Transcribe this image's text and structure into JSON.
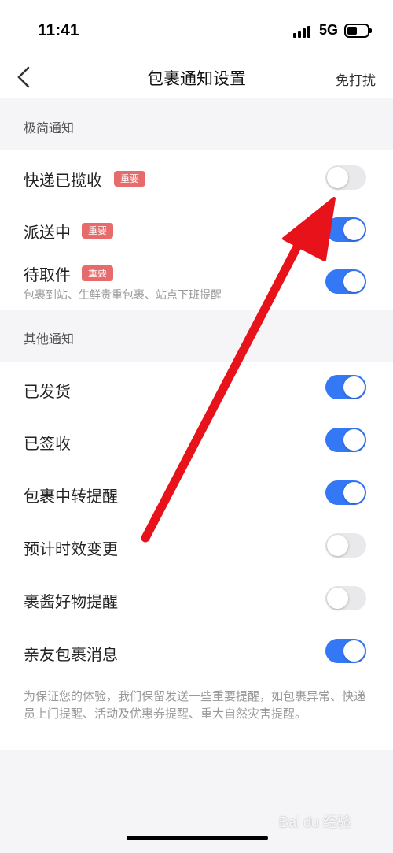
{
  "status": {
    "time": "11:41",
    "network": "5G"
  },
  "nav": {
    "title": "包裹通知设置",
    "right_label": "免打扰"
  },
  "sections": {
    "minimal": {
      "title": "极简通知"
    },
    "other": {
      "title": "其他通知"
    }
  },
  "minimal_items": [
    {
      "label": "快递已揽收",
      "badge": "重要",
      "enabled": false
    },
    {
      "label": "派送中",
      "badge": "重要",
      "enabled": true
    },
    {
      "label": "待取件",
      "badge": "重要",
      "subtitle": "包裹到站、生鲜贵重包裹、站点下班提醒",
      "enabled": true
    }
  ],
  "other_items": [
    {
      "label": "已发货",
      "enabled": true
    },
    {
      "label": "已签收",
      "enabled": true
    },
    {
      "label": "包裹中转提醒",
      "enabled": true
    },
    {
      "label": "预计时效变更",
      "enabled": false
    },
    {
      "label": "裹酱好物提醒",
      "enabled": false
    },
    {
      "label": "亲友包裹消息",
      "enabled": true
    }
  ],
  "footer_note": "为保证您的体验，我们保留发送一些重要提醒，如包裹异常、快递员上门提醒、活动及优惠券提醒、重大自然灾害提醒。",
  "watermark": "Bai du 经验",
  "colors": {
    "accent": "#3478f6",
    "badge": "#e86b6b",
    "arrow": "#e8121a"
  }
}
